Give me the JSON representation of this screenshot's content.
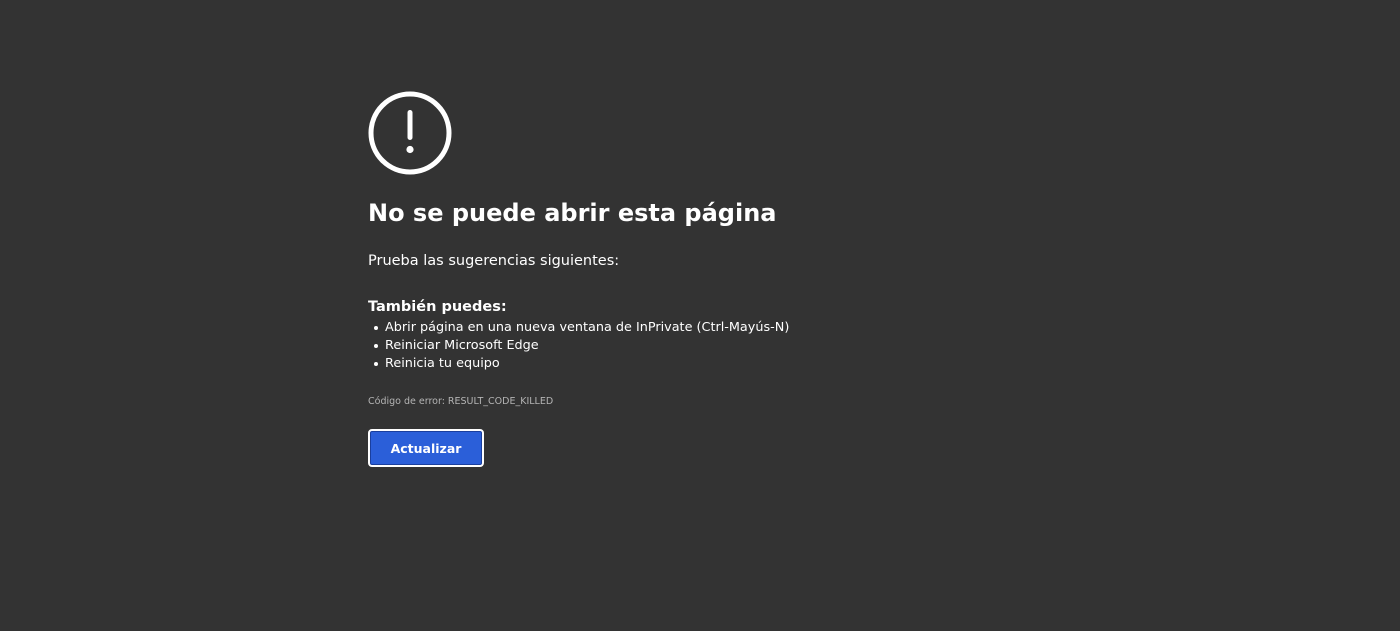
{
  "main": {
    "icon": "exclamation-circle-icon",
    "title": "No se puede abrir esta página",
    "subtitle": "Prueba las sugerencias siguientes:",
    "also_heading": "También puedes:",
    "suggestions": [
      "Abrir página en una nueva ventana de InPrivate (Ctrl-Mayús-N)",
      "Reiniciar Microsoft Edge",
      "Reinicia tu equipo"
    ],
    "error_code": "Código de error: RESULT_CODE_KILLED",
    "refresh_button_label": "Actualizar"
  },
  "colors": {
    "background": "#333333",
    "text": "#ffffff",
    "error_code_text": "#b4b4b4",
    "button_background": "#2b5fd9",
    "button_border": "#ffffff"
  }
}
